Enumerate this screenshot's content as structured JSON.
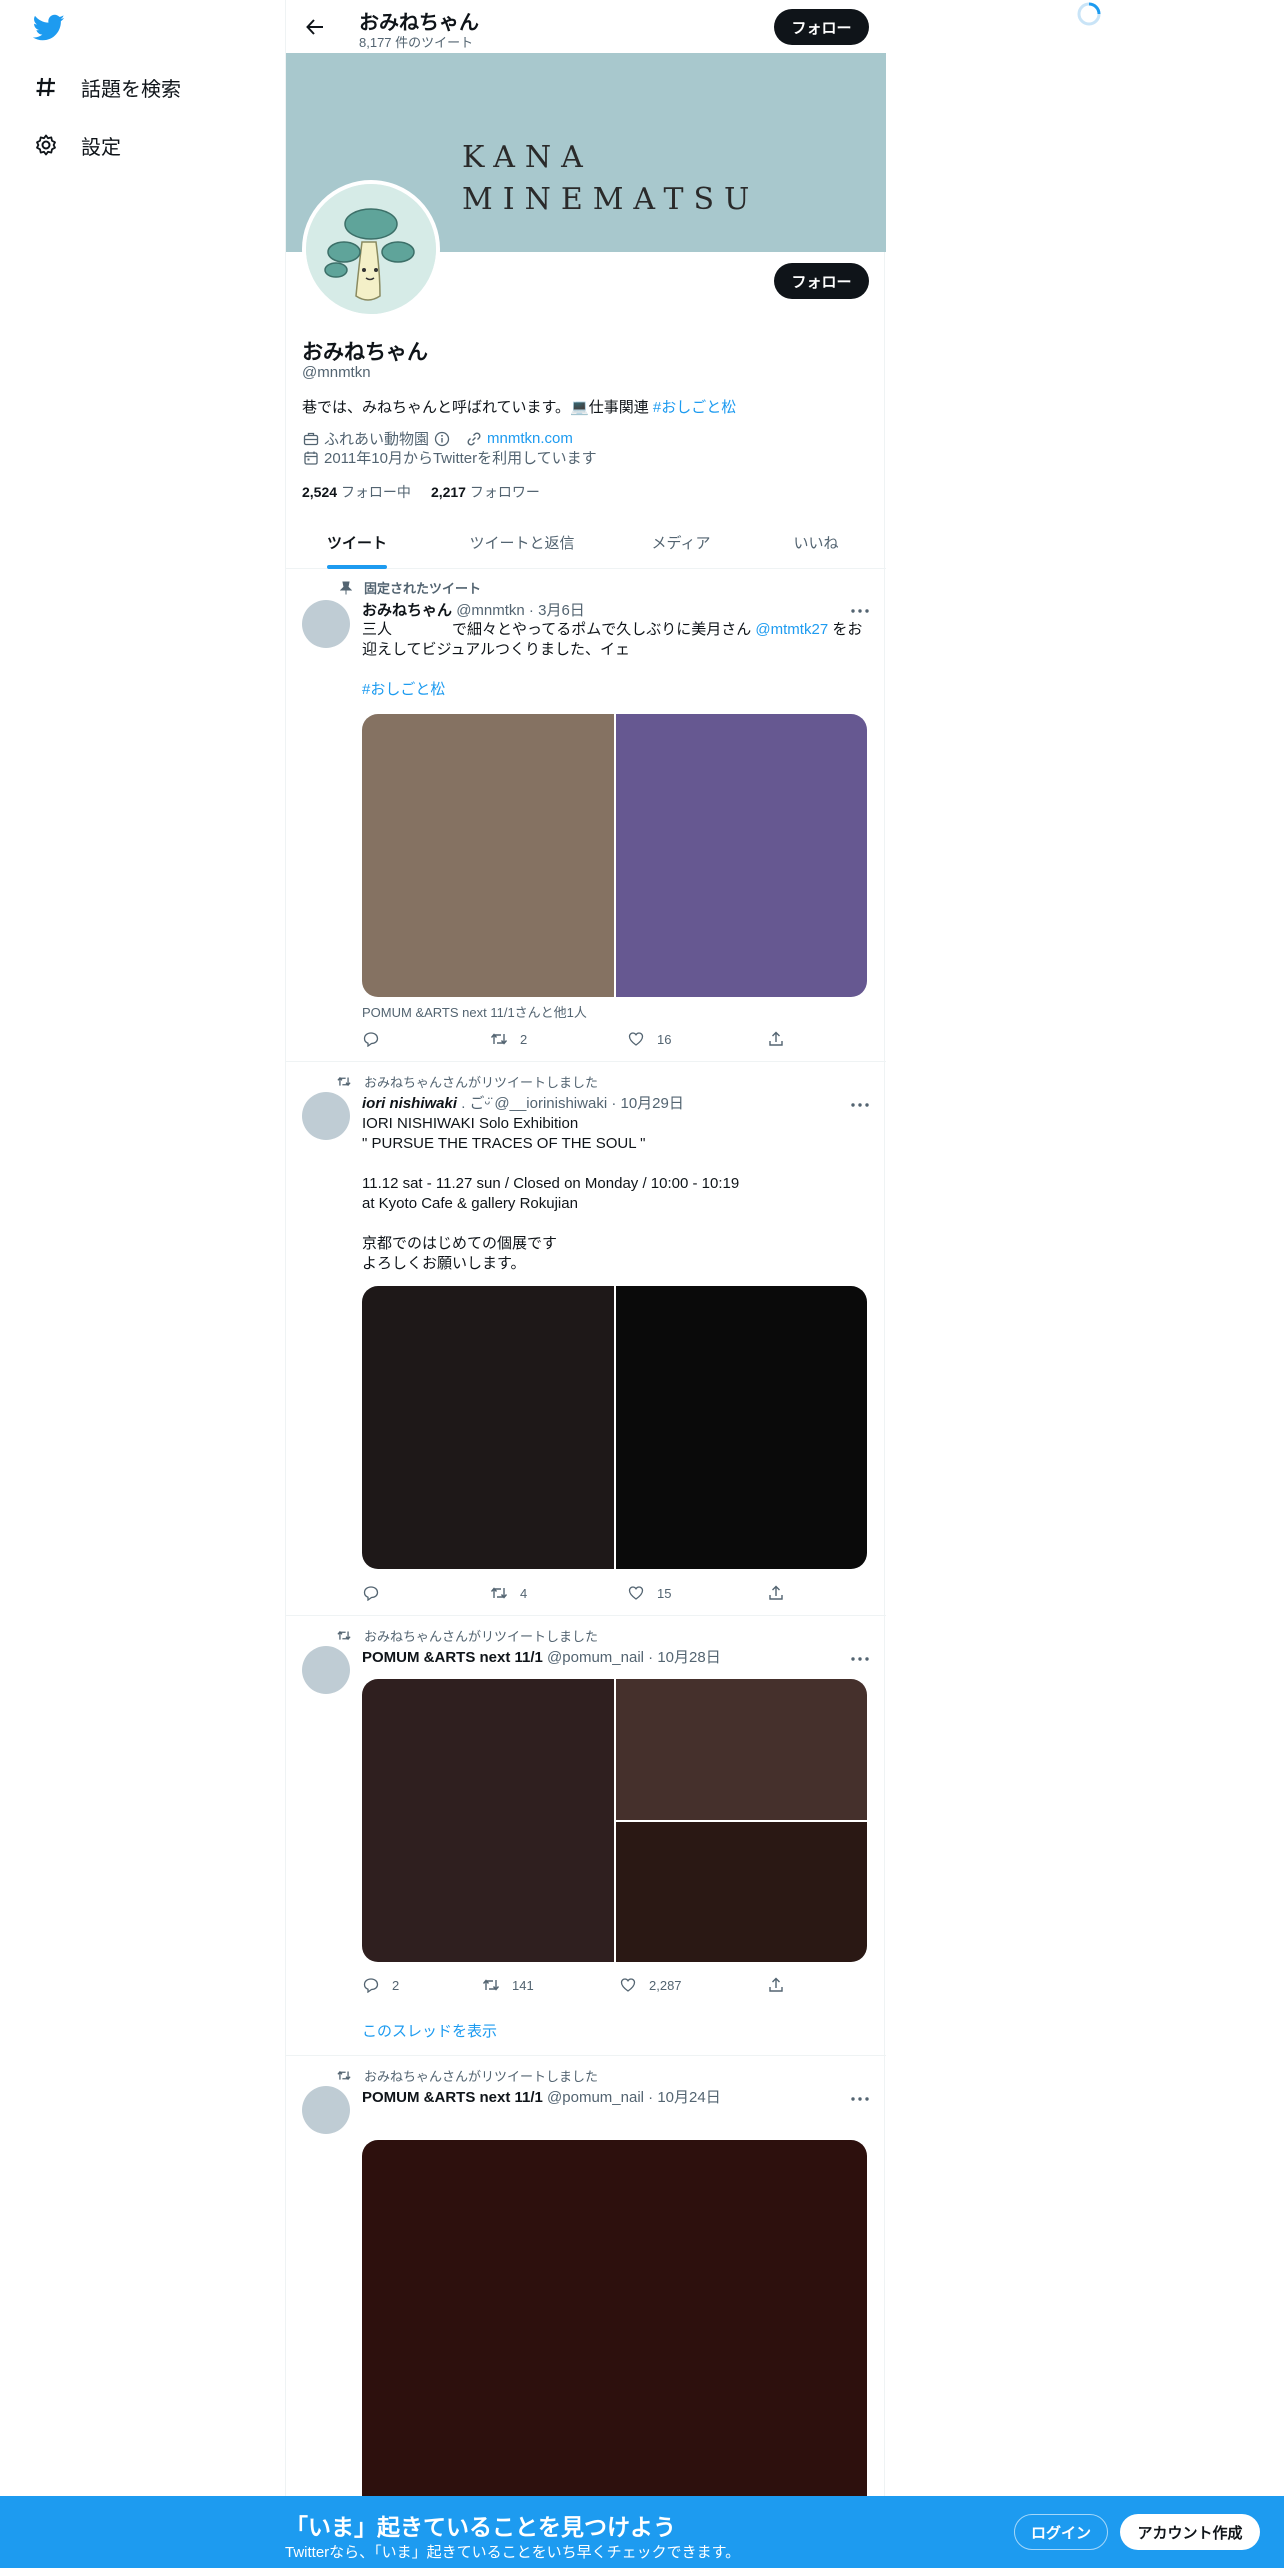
{
  "nav": {
    "explore_label": "話題を検索",
    "settings_label": "設定"
  },
  "header": {
    "name": "おみねちゃん",
    "tweet_count": "8,177 件のツイート",
    "follow_label": "フォロー"
  },
  "banner": {
    "line1": "KANA",
    "line2": "MINEMATSU",
    "color": "#a8c8cd"
  },
  "profile": {
    "name": "おみねちゃん",
    "handle": "@mnmtkn",
    "bio_text": "巷では、みねちゃんと呼ばれています。",
    "bio_emoji": "💻",
    "bio_work": "仕事関連 ",
    "bio_hashtag": "#おしごと松",
    "category": "ふれあい動物園",
    "website": "mnmtkn.com",
    "joined": "2011年10月からTwitterを利用しています",
    "following_count": "2,524",
    "following_label": "フォロー中",
    "followers_count": "2,217",
    "followers_label": "フォロワー",
    "follow_label": "フォロー"
  },
  "tabs": [
    {
      "label": "ツイート"
    },
    {
      "label": "ツイートと返信"
    },
    {
      "label": "メディア"
    },
    {
      "label": "いいね"
    }
  ],
  "tweets": [
    {
      "context": "固定されたツイート",
      "name": "おみねちゃん",
      "handle": "@mnmtkn",
      "sep": " · ",
      "date": "3月6日",
      "text_line1_a": "三人　　　　で細々とやってるポムで久しぶりに美月さん ",
      "mention": "@mtmtk27",
      "text_line1_b": " をお",
      "text_line2": "迎えしてビジュアルつくりました、イェ",
      "hashtag": "#おしごと松",
      "tagged": "POMUM &ARTS next 11/1さんと他1人",
      "reply": "",
      "retweet": "2",
      "like": "16",
      "media_colors": [
        "#857262",
        "#665891"
      ]
    },
    {
      "context": "おみねちゃんさんがリツイートしました",
      "name": "iori nishiwaki",
      "name_suffix": " . ごᵕ̈",
      "handle": "@__iorinishiwaki",
      "sep": " · ",
      "date": "10月29日",
      "lines": [
        "IORI NISHIWAKI  Solo Exhibition",
        "\" PURSUE THE TRACES OF THE SOUL \"",
        "",
        "11.12 sat - 11.27 sun / Closed on Monday / 10:00 - 10:19",
        "at Kyoto Cafe & gallery Rokujian",
        "",
        "京都でのはじめての個展です",
        "よろしくお願いします。"
      ],
      "reply": "",
      "retweet": "4",
      "like": "15",
      "media_colors": [
        "#1e1818",
        "#0a0a0a"
      ]
    },
    {
      "context": "おみねちゃんさんがリツイートしました",
      "name": "POMUM &ARTS next 11/1",
      "handle": "@pomum_nail",
      "sep": " · ",
      "date": "10月28日",
      "reply": "2",
      "retweet": "141",
      "like": "2,287",
      "show_thread": "このスレッドを表示",
      "media_colors": [
        "#2f1f1f",
        "#45302c",
        "#2a1814"
      ]
    },
    {
      "context": "おみねちゃんさんがリツイートしました",
      "name": "POMUM &ARTS next 11/1",
      "handle": "@pomum_nail",
      "sep": " · ",
      "date": "10月24日",
      "media_colors": [
        "#2d100d"
      ]
    }
  ],
  "bottom_bar": {
    "title": "「いま」起きていることを見つけよう",
    "subtitle": "Twitterなら、「いま」起きていることをいち早くチェックできます。",
    "login_label": "ログイン",
    "signup_label": "アカウント作成",
    "background": "#1d9bf0"
  }
}
